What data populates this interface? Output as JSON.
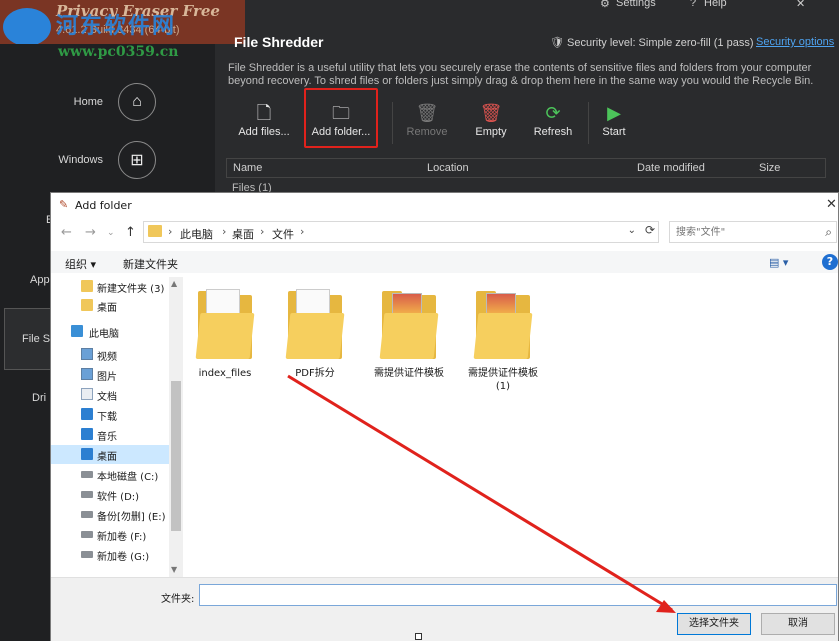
{
  "background_app": {
    "app_name": "Privacy Eraser Free",
    "app_version": "4.61.2 Build 3434 (64-bit)",
    "watermark_text": "河东软件网",
    "watermark_url": "www.pc0359.cn",
    "topbar": {
      "settings": "Settings",
      "help": "Help"
    },
    "nav": [
      {
        "label": "Home",
        "icon": "home-icon",
        "glyph": "⌂"
      },
      {
        "label": "Windows",
        "icon": "windows-icon",
        "glyph": "⊞"
      }
    ],
    "nav_partial": {
      "apps": "Appl",
      "file_shredder": "File S",
      "drive": "Dri",
      "e": "E"
    },
    "page_title": "File Shredder",
    "security_level": "Security level: Simple zero-fill (1 pass)",
    "security_options": "Security options",
    "description": "File Shredder is a useful utility that lets you securely erase the contents of sensitive files and folders from your computer beyond recovery. To shred files or folders just simply drag & drop them here in the same way you would the Recycle Bin.",
    "toolbar": [
      {
        "label": "Add files...",
        "icon": "add-files-icon",
        "glyph": "🗋",
        "enabled": true
      },
      {
        "label": "Add folder...",
        "icon": "add-folder-icon",
        "glyph": "🗀",
        "enabled": true
      },
      {
        "label": "Remove",
        "icon": "remove-icon",
        "glyph": "🗑",
        "enabled": false
      },
      {
        "label": "Empty",
        "icon": "empty-icon",
        "glyph": "🗑",
        "enabled": true
      },
      {
        "label": "Refresh",
        "icon": "refresh-icon",
        "glyph": "⟳",
        "enabled": true
      },
      {
        "label": "Start",
        "icon": "start-icon",
        "glyph": "▶",
        "enabled": true
      }
    ],
    "grid_columns": [
      "Name",
      "Location",
      "Date modified",
      "Size"
    ],
    "grid_group": "Files (1)"
  },
  "dialog": {
    "title": "Add folder",
    "breadcrumb": [
      "此电脑",
      "桌面",
      "文件"
    ],
    "search_placeholder": "搜索\"文件\"",
    "commands": {
      "organize": "组织 ▾",
      "new_folder": "新建文件夹"
    },
    "tree": [
      {
        "label": "新建文件夹 (3)",
        "icon": "folder-icon",
        "type": "folder",
        "indent": 1
      },
      {
        "label": "桌面",
        "icon": "folder-icon",
        "type": "folder",
        "indent": 1
      },
      {
        "label": "此电脑",
        "icon": "computer-icon",
        "type": "pc",
        "indent": 0
      },
      {
        "label": "视频",
        "icon": "video-icon",
        "type": "img",
        "indent": 1
      },
      {
        "label": "图片",
        "icon": "pictures-icon",
        "type": "img",
        "indent": 1
      },
      {
        "label": "文档",
        "icon": "documents-icon",
        "type": "doc",
        "indent": 1
      },
      {
        "label": "下载",
        "icon": "download-icon",
        "type": "blue",
        "indent": 1
      },
      {
        "label": "音乐",
        "icon": "music-icon",
        "type": "blue",
        "indent": 1
      },
      {
        "label": "桌面",
        "icon": "desktop-icon",
        "type": "blue",
        "indent": 1,
        "selected": true
      },
      {
        "label": "本地磁盘 (C:)",
        "icon": "drive-icon",
        "type": "drive",
        "indent": 1
      },
      {
        "label": "软件 (D:)",
        "icon": "drive-icon",
        "type": "drive",
        "indent": 1
      },
      {
        "label": "备份[勿删] (E:)",
        "icon": "drive-icon",
        "type": "drive",
        "indent": 1
      },
      {
        "label": "新加卷 (F:)",
        "icon": "drive-icon",
        "type": "drive",
        "indent": 1
      },
      {
        "label": "新加卷 (G:)",
        "icon": "drive-icon",
        "type": "drive",
        "indent": 1
      }
    ],
    "files": [
      {
        "name": "index_files",
        "kind": "paper"
      },
      {
        "name": "PDF拆分",
        "kind": "paper"
      },
      {
        "name": "需提供证件模板",
        "kind": "photo"
      },
      {
        "name": "需提供证件模板 (1)",
        "kind": "photo"
      }
    ],
    "folder_label": "文件夹:",
    "folder_value": "",
    "select_button": "选择文件夹",
    "cancel_button": "取消"
  },
  "colors": {
    "highlight": "#e0221c",
    "accent_blue": "#0078d7",
    "selected_bg": "#cce8ff"
  }
}
